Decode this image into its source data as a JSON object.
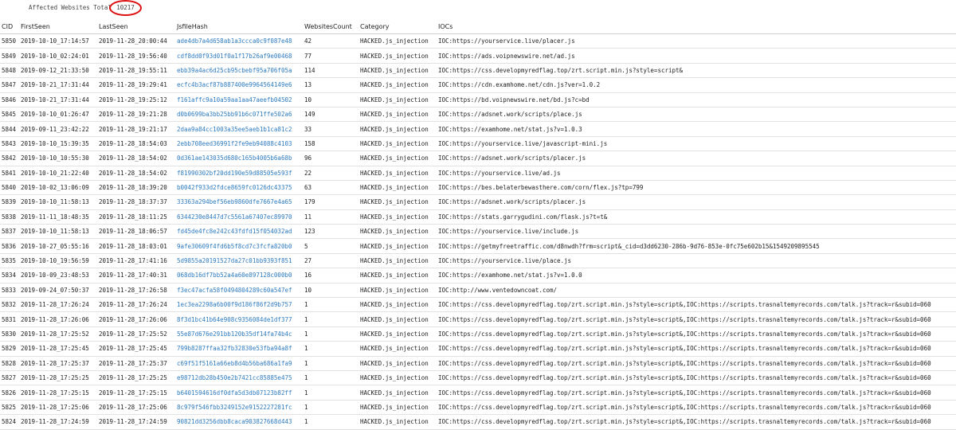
{
  "summary": {
    "label": "Affected Websites Total",
    "value": "10217"
  },
  "table": {
    "columns": [
      "CID",
      "FirstSeen",
      "LastSeen",
      "JsfileHash",
      "WebsitesCount",
      "Category",
      "IOCs"
    ],
    "rows": [
      [
        "5850",
        "2019-10-10_17:14:57",
        "2019-11-28_20:00:44",
        "ade4db7a4d658ab1a3ccca0c9f087e48",
        "42",
        "HACKED.js_injection",
        "IOC:https://yourservice.live/placer.js"
      ],
      [
        "5849",
        "2019-10-10_02:24:01",
        "2019-11-28_19:56:40",
        "cdf8dd0f93d01f0a1f17b26af9e00468",
        "77",
        "HACKED.js_injection",
        "IOC:https://ads.voipnewswire.net/ad.js"
      ],
      [
        "5848",
        "2019-09-12_21:33:50",
        "2019-11-28_19:55:11",
        "ebb39a4ac6d25cb95cbebf95a706f05a",
        "114",
        "HACKED.js_injection",
        "IOC:https://css.developmyredflag.top/zrt.script.min.js?style=script&"
      ],
      [
        "5847",
        "2019-10-21_17:31:44",
        "2019-11-28_19:29:41",
        "ecfc4b3acf87b887400e9964564149e6",
        "13",
        "HACKED.js_injection",
        "IOC:https://cdn.examhome.net/cdn.js?ver=1.0.2"
      ],
      [
        "5846",
        "2019-10-21_17:31:44",
        "2019-11-28_19:25:12",
        "f161affc9a10a59aa1aa47aeefb04502",
        "10",
        "HACKED.js_injection",
        "IOC:https://bd.voipnewswire.net/bd.js?c=bd"
      ],
      [
        "5845",
        "2019-10-10_01:26:47",
        "2019-11-28_19:21:28",
        "d0b0699ba3bb25bb91b6c071ffe502a6",
        "149",
        "HACKED.js_injection",
        "IOC:https://adsnet.work/scripts/place.js"
      ],
      [
        "5844",
        "2019-09-11_23:42:22",
        "2019-11-28_19:21:17",
        "2daa9a84cc1003a35ee5aeb1b1ca81c2",
        "33",
        "HACKED.js_injection",
        "IOC:https://examhome.net/stat.js?v=1.0.3"
      ],
      [
        "5843",
        "2019-10-10_15:39:35",
        "2019-11-28_18:54:03",
        "2ebb708eed36991f2fe9eb94088c4103",
        "158",
        "HACKED.js_injection",
        "IOC:https://yourservice.live/javascript-mini.js"
      ],
      [
        "5842",
        "2019-10-10_10:55:30",
        "2019-11-28_18:54:02",
        "0d361ae143035d680c165b4005b6a68b",
        "96",
        "HACKED.js_injection",
        "IOC:https://adsnet.work/scripts/placer.js"
      ],
      [
        "5841",
        "2019-10-10_21:22:40",
        "2019-11-28_18:54:02",
        "f81990302bf20dd190e59d88505e593f",
        "22",
        "HACKED.js_injection",
        "IOC:https://yourservice.live/ad.js"
      ],
      [
        "5840",
        "2019-10-02_13:06:09",
        "2019-11-28_18:39:20",
        "b0042f933d2fdce8659fc0126dc43375",
        "63",
        "HACKED.js_injection",
        "IOC:https://bes.belaterbewasthere.com/corn/flex.js?tp=799"
      ],
      [
        "5839",
        "2019-10-10_11:58:13",
        "2019-11-28_18:37:37",
        "33363a294bef56eb9860dfe7667e4a65",
        "179",
        "HACKED.js_injection",
        "IOC:https://adsnet.work/scripts/placer.js"
      ],
      [
        "5838",
        "2019-11-11_18:48:35",
        "2019-11-28_18:11:25",
        "6344230e8447d7c5561a67407ec89970",
        "11",
        "HACKED.js_injection",
        "IOC:https://stats.garrygudini.com/flask.js?t=t&"
      ],
      [
        "5837",
        "2019-10-10_11:58:13",
        "2019-11-28_18:06:57",
        "fd45de4fc8e242c43fdfd15f054032ad",
        "123",
        "HACKED.js_injection",
        "IOC:https://yourservice.live/include.js"
      ],
      [
        "5836",
        "2019-10-27_05:55:16",
        "2019-11-28_18:03:01",
        "9afe30609f4fd6b5f8cd7c3fcfa820b0",
        "5",
        "HACKED.js_injection",
        "IOC:https://getmyfreetraffic.com/d8nwdh?frm=script&_cid=d3dd6230-286b-9d76-853e-0fc75e602b15&1549209895545"
      ],
      [
        "5835",
        "2019-10-10_19:56:59",
        "2019-11-28_17:41:16",
        "5d9855a20191527da27c01bb9393f851",
        "27",
        "HACKED.js_injection",
        "IOC:https://yourservice.live/place.js"
      ],
      [
        "5834",
        "2019-10-09_23:48:53",
        "2019-11-28_17:40:31",
        "068db16df7bb52a4a60e897128c000b0",
        "16",
        "HACKED.js_injection",
        "IOC:https://examhome.net/stat.js?v=1.0.0"
      ],
      [
        "5833",
        "2019-09-24_07:50:37",
        "2019-11-28_17:26:58",
        "f3ec47acfa58f0494804289c60a547ef",
        "10",
        "HACKED.js_injection",
        "IOC:http://www.ventedowncoat.com/"
      ],
      [
        "5832",
        "2019-11-28_17:26:24",
        "2019-11-28_17:26:24",
        "1ec3ea2298a6b00f9d186f86f2d9b757",
        "1",
        "HACKED.js_injection",
        "IOC:https://css.developmyredflag.top/zrt.script.min.js?style=script&,IOC:https://scripts.trasnaltemyrecords.com/talk.js?track=r&subid=060"
      ],
      [
        "5831",
        "2019-11-28_17:26:06",
        "2019-11-28_17:26:06",
        "8f3d1bc41b64e908c9356084de1df377",
        "1",
        "HACKED.js_injection",
        "IOC:https://css.developmyredflag.top/zrt.script.min.js?style=script&,IOC:https://scripts.trasnaltemyrecords.com/talk.js?track=r&subid=060"
      ],
      [
        "5830",
        "2019-11-28_17:25:52",
        "2019-11-28_17:25:52",
        "55e87d676e291bb120b35df14fa74b4c",
        "1",
        "HACKED.js_injection",
        "IOC:https://css.developmyredflag.top/zrt.script.min.js?style=script&,IOC:https://scripts.trasnaltemyrecords.com/talk.js?track=r&subid=060"
      ],
      [
        "5829",
        "2019-11-28_17:25:45",
        "2019-11-28_17:25:45",
        "799b8287ffaa32fb32830e53fba94a8f",
        "1",
        "HACKED.js_injection",
        "IOC:https://css.developmyredflag.top/zrt.script.min.js?style=script&,IOC:https://scripts.trasnaltemyrecords.com/talk.js?track=r&subid=060"
      ],
      [
        "5828",
        "2019-11-28_17:25:37",
        "2019-11-28_17:25:37",
        "c69f51f5161a66eb8d4b56ba686a1fa9",
        "1",
        "HACKED.js_injection",
        "IOC:https://css.developmyredflag.top/zrt.script.min.js?style=script&,IOC:https://scripts.trasnaltemyrecords.com/talk.js?track=r&subid=060"
      ],
      [
        "5827",
        "2019-11-28_17:25:25",
        "2019-11-28_17:25:25",
        "e98712db28b450e2b7421cc85885e475",
        "1",
        "HACKED.js_injection",
        "IOC:https://css.developmyredflag.top/zrt.script.min.js?style=script&,IOC:https://scripts.trasnaltemyrecords.com/talk.js?track=r&subid=060"
      ],
      [
        "5826",
        "2019-11-28_17:25:15",
        "2019-11-28_17:25:15",
        "b6401594616df0dfa5d3db07123b82ff",
        "1",
        "HACKED.js_injection",
        "IOC:https://css.developmyredflag.top/zrt.script.min.js?style=script&,IOC:https://scripts.trasnaltemyrecords.com/talk.js?track=r&subid=060"
      ],
      [
        "5825",
        "2019-11-28_17:25:06",
        "2019-11-28_17:25:06",
        "8c979f546fbb3249152e9152227281fc",
        "1",
        "HACKED.js_injection",
        "IOC:https://css.developmyredflag.top/zrt.script.min.js?style=script&,IOC:https://scripts.trasnaltemyrecords.com/talk.js?track=r&subid=060"
      ],
      [
        "5824",
        "2019-11-28_17:24:59",
        "2019-11-28_17:24:59",
        "90821dd3256dbb8caca903827668d443",
        "1",
        "HACKED.js_injection",
        "IOC:https://css.developmyredflag.top/zrt.script.min.js?style=script&,IOC:https://scripts.trasnaltemyrecords.com/talk.js?track=r&subid=060"
      ]
    ]
  },
  "colors": {
    "hash_link": "#2e7bbf",
    "highlight_circle": "#d11111"
  }
}
